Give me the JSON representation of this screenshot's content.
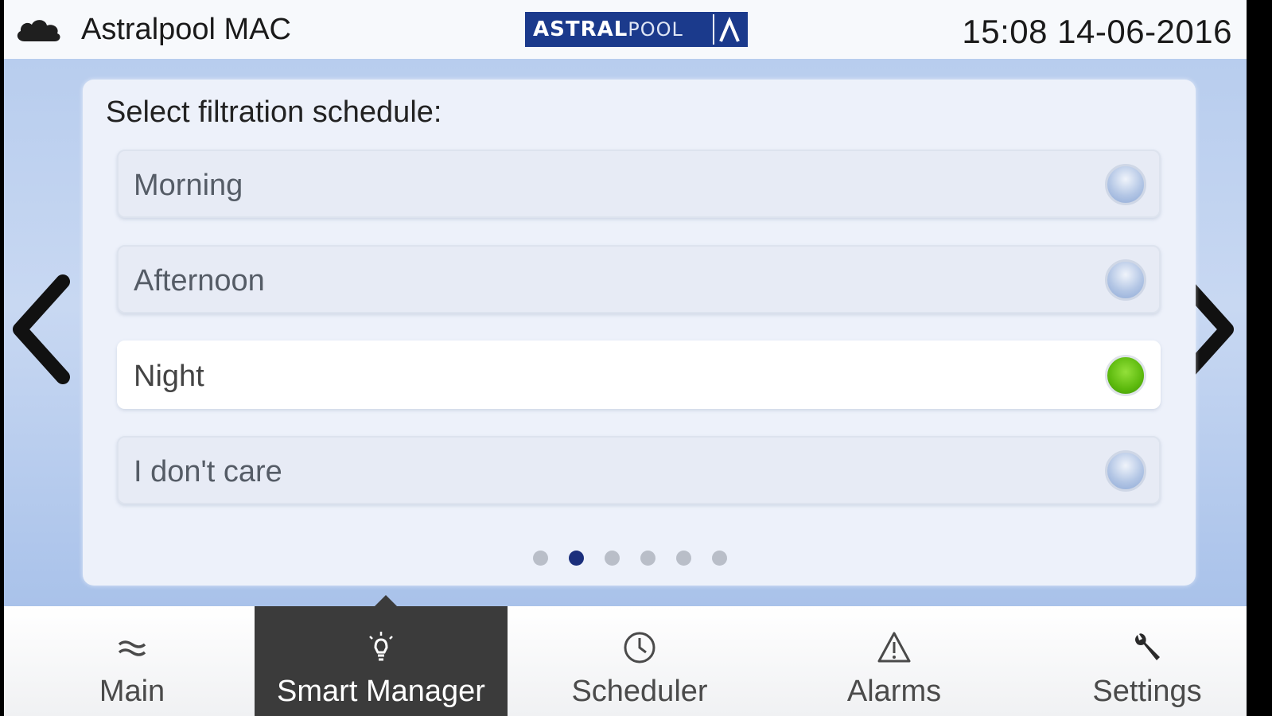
{
  "header": {
    "app_title": "Astralpool MAC",
    "logo_bold": "ASTRAL",
    "logo_light": "POOL",
    "datetime": "15:08 14-06-2016",
    "status_icon": "cloud-icon"
  },
  "panel": {
    "title": "Select filtration schedule:",
    "options": [
      {
        "label": "Morning",
        "selected": false
      },
      {
        "label": "Afternoon",
        "selected": false
      },
      {
        "label": "Night",
        "selected": true
      },
      {
        "label": "I don't care",
        "selected": false
      }
    ],
    "page_count": 6,
    "current_page": 2
  },
  "arrows": {
    "prev_icon": "chevron-left-icon",
    "next_icon": "chevron-right-icon"
  },
  "nav": {
    "items": [
      {
        "label": "Main",
        "icon": "waves-icon",
        "active": false
      },
      {
        "label": "Smart Manager",
        "icon": "lightbulb-icon",
        "active": true
      },
      {
        "label": "Scheduler",
        "icon": "clock-icon",
        "active": false
      },
      {
        "label": "Alarms",
        "icon": "warning-icon",
        "active": false
      },
      {
        "label": "Settings",
        "icon": "wrench-icon",
        "active": false
      }
    ]
  },
  "colors": {
    "selected_radio": "#5cb90d",
    "active_dot": "#1b2f7c",
    "active_tab": "#3b3b3b",
    "logo_bg": "#1b3a8c"
  }
}
